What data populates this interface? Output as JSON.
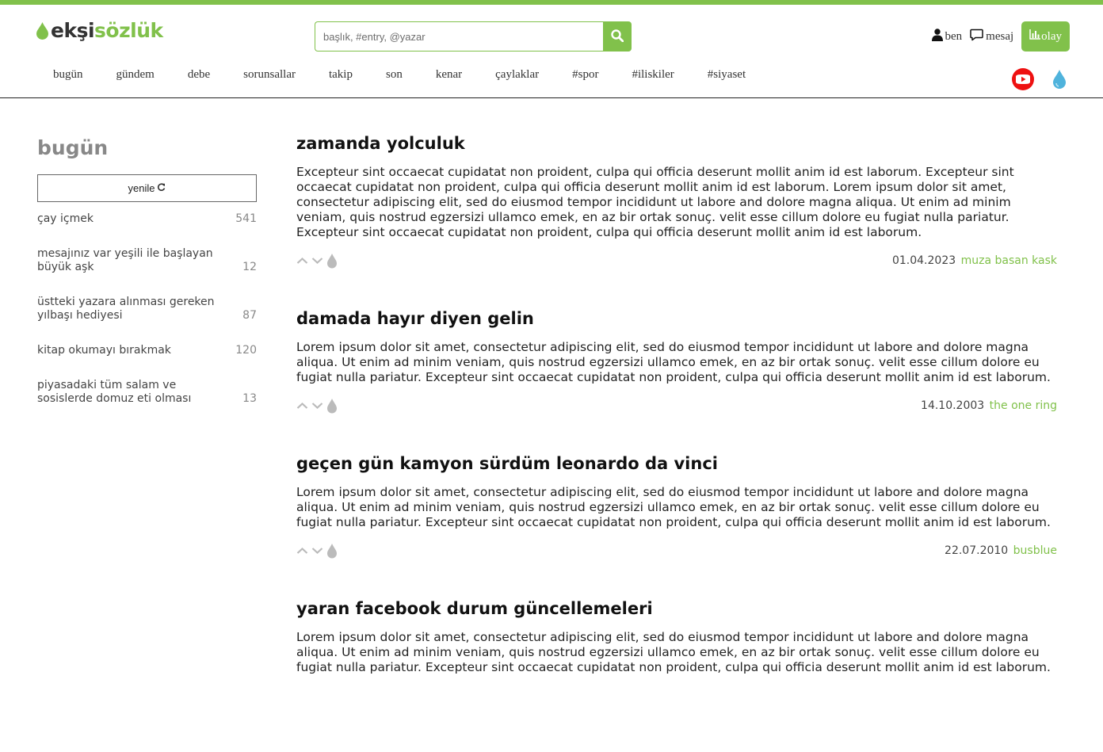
{
  "brand": {
    "logo_a": "ekşi",
    "logo_b": "sözlük",
    "accent": "#81c14b"
  },
  "search": {
    "placeholder": "başlık, #entry, @yazar"
  },
  "user_nav": {
    "ben": "ben",
    "mesaj": "mesaj",
    "olay": "olay"
  },
  "nav": [
    "bugün",
    "gündem",
    "debe",
    "sorunsallar",
    "takip",
    "son",
    "kenar",
    "çaylaklar",
    "#spor",
    "#iliskiler",
    "#siyaset"
  ],
  "sidebar": {
    "title": "bugün",
    "refresh": "yenile",
    "topics": [
      {
        "title": "çay içmek",
        "count": "541"
      },
      {
        "title": "mesajınız var yeşili ile başlayan büyük aşk",
        "count": "12"
      },
      {
        "title": "üstteki yazara alınması gereken yılbaşı hediyesi",
        "count": "87"
      },
      {
        "title": "kitap okumayı bırakmak",
        "count": "120"
      },
      {
        "title": "piyasadaki tüm salam ve sosislerde domuz eti olması",
        "count": "13"
      }
    ]
  },
  "entries": [
    {
      "title": "zamanda yolculuk",
      "body": "Excepteur sint occaecat cupidatat non proident, culpa qui officia deserunt mollit anim id est laborum. Excepteur sint occaecat cupidatat non proident, culpa qui officia deserunt mollit anim id est laborum. Lorem ipsum dolor sit amet, consectetur adipiscing elit, sed do eiusmod tempor incididunt ut labore and dolore magna aliqua. Ut enim ad minim veniam, quis nostrud egzersizi ullamco emek, en az bir ortak sonuç. velit esse cillum dolore eu fugiat nulla pariatur. Excepteur sint occaecat cupidatat non proident, culpa qui officia deserunt mollit anim id est laborum.",
      "date": "01.04.2023",
      "author": "muza basan kask"
    },
    {
      "title": "damada hayır diyen gelin",
      "body": "Lorem ipsum dolor sit amet, consectetur adipiscing elit, sed do eiusmod tempor incididunt ut labore and dolore magna aliqua. Ut enim ad minim veniam, quis nostrud egzersizi ullamco emek, en az bir ortak sonuç. velit esse cillum dolore eu fugiat nulla pariatur. Excepteur sint occaecat cupidatat non proident, culpa qui officia deserunt mollit anim id est laborum.",
      "date": "14.10.2003",
      "author": "the one ring"
    },
    {
      "title": "geçen gün kamyon sürdüm leonardo da vinci",
      "body": "Lorem ipsum dolor sit amet, consectetur adipiscing elit, sed do eiusmod tempor incididunt ut labore and dolore magna aliqua. Ut enim ad minim veniam, quis nostrud egzersizi ullamco emek, en az bir ortak sonuç. velit esse cillum dolore eu fugiat nulla pariatur. Excepteur sint occaecat cupidatat non proident, culpa qui officia deserunt mollit anim id est laborum.",
      "date": "22.07.2010",
      "author": "busblue"
    },
    {
      "title": "yaran facebook durum güncellemeleri",
      "body": "Lorem ipsum dolor sit amet, consectetur adipiscing elit, sed do eiusmod tempor incididunt ut labore and dolore magna aliqua. Ut enim ad minim veniam, quis nostrud egzersizi ullamco emek, en az bir ortak sonuç. velit esse cillum dolore eu fugiat nulla pariatur. Excepteur sint occaecat cupidatat non proident, culpa qui officia deserunt mollit anim id est laborum.",
      "date": "",
      "author": ""
    }
  ],
  "icons": {
    "logo": "drop-icon",
    "search": "search-icon",
    "user": "user-icon",
    "message": "message-icon",
    "olay": "bar-chart-icon",
    "youtube": "youtube-icon",
    "drop": "drop-icon",
    "refresh": "refresh-icon",
    "upvote": "chevron-up-icon",
    "downvote": "chevron-down-icon",
    "favorite": "drop-icon"
  }
}
